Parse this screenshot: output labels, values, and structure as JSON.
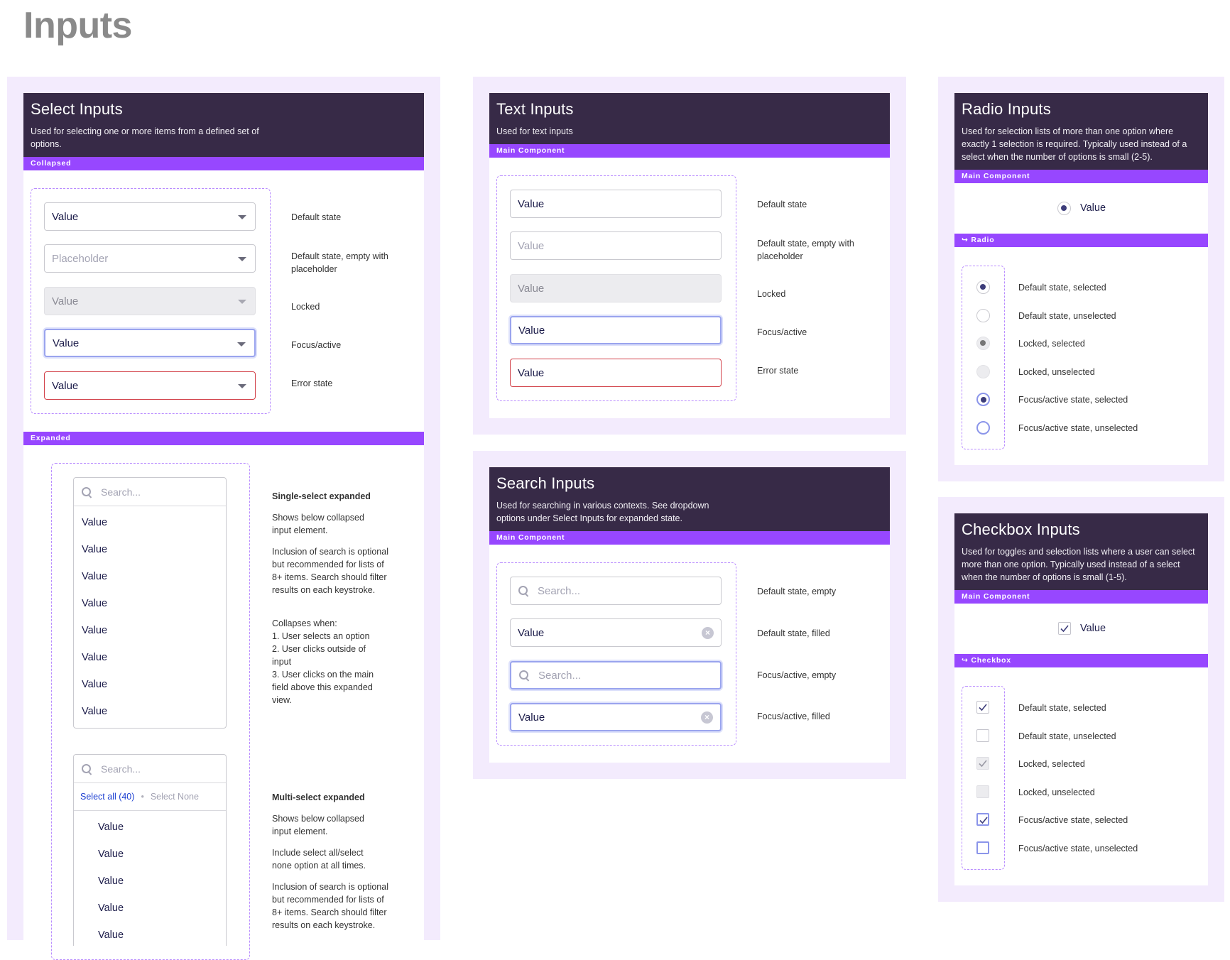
{
  "page": {
    "title": "Inputs"
  },
  "colors": {
    "header_bg": "#372a47",
    "accent_bar": "#9747ff",
    "outer_bg": "#f3ebfd",
    "focus": "#9aa4ee",
    "error": "#d2424a",
    "link": "#1c3fd1"
  },
  "select": {
    "title": "Select Inputs",
    "desc": "Used for selecting one or more items from a defined set of options.",
    "bar_collapsed": "Collapsed",
    "bar_expanded": "Expanded",
    "collapsed": [
      {
        "value": "Value",
        "label": "Default state"
      },
      {
        "value": "Placeholder",
        "label": "Default state, empty with placeholder"
      },
      {
        "value": "Value",
        "label": "Locked"
      },
      {
        "value": "Value",
        "label": "Focus/active"
      },
      {
        "value": "Value",
        "label": "Error state"
      }
    ],
    "single": {
      "search_placeholder": "Search...",
      "options": [
        "Value",
        "Value",
        "Value",
        "Value",
        "Value",
        "Value",
        "Value",
        "Value"
      ],
      "heading": "Single-select expanded",
      "p1": "Shows below collapsed input element.",
      "p2": "Inclusion of search is optional but recommended for lists of 8+ items. Search should filter results on each keystroke.",
      "p3": "Collapses when:\n1. User selects an option\n2. User clicks outside of input\n3. User clicks on the main field above this expanded view."
    },
    "multi": {
      "search_placeholder": "Search...",
      "select_all": "Select all (40)",
      "separator": "•",
      "select_none": "Select None",
      "options": [
        "Value",
        "Value",
        "Value",
        "Value",
        "Value"
      ],
      "heading": "Multi-select expanded",
      "p1": "Shows below collapsed input element.",
      "p2": "Include select all/select none option at all times.",
      "p3": "Inclusion of search is optional but recommended for lists of 8+ items. Search should filter results on each keystroke."
    }
  },
  "text": {
    "title": "Text Inputs",
    "desc": "Used for text inputs",
    "bar": "Main Component",
    "items": [
      {
        "value": "Value",
        "label": "Default state"
      },
      {
        "value": "Value",
        "label": "Default state, empty with placeholder"
      },
      {
        "value": "Value",
        "label": "Locked"
      },
      {
        "value": "Value",
        "label": "Focus/active"
      },
      {
        "value": "Value",
        "label": "Error state"
      }
    ]
  },
  "search": {
    "title": "Search Inputs",
    "desc": "Used for searching in various contexts. See dropdown options under Select Inputs for expanded state.",
    "bar": "Main Component",
    "items": [
      {
        "value": "Search...",
        "label": "Default state, empty"
      },
      {
        "value": "Value",
        "label": "Default state, filled"
      },
      {
        "value": "Search...",
        "label": "Focus/active, empty"
      },
      {
        "value": "Value",
        "label": "Focus/active, filled"
      }
    ]
  },
  "radio": {
    "title": "Radio Inputs",
    "desc": "Used for selection lists of more than one option where exactly 1 selection is required. Typically used instead of a select when the number of options is small (2-5).",
    "bar": "Main Component",
    "main_label": "Value",
    "variant_bar": "↪ Radio",
    "items": [
      "Default state, selected",
      "Default state, unselected",
      "Locked, selected",
      "Locked, unselected",
      "Focus/active state, selected",
      "Focus/active state, unselected"
    ]
  },
  "checkbox": {
    "title": "Checkbox Inputs",
    "desc": "Used for toggles and selection lists where a user can select more than one option. Typically used instead of a select when the number of options is small (1-5).",
    "bar": "Main Component",
    "main_label": "Value",
    "variant_bar": "↪ Checkbox",
    "items": [
      "Default state, selected",
      "Default state, unselected",
      "Locked, selected",
      "Locked, unselected",
      "Focus/active state, selected",
      "Focus/active state, unselected"
    ]
  }
}
